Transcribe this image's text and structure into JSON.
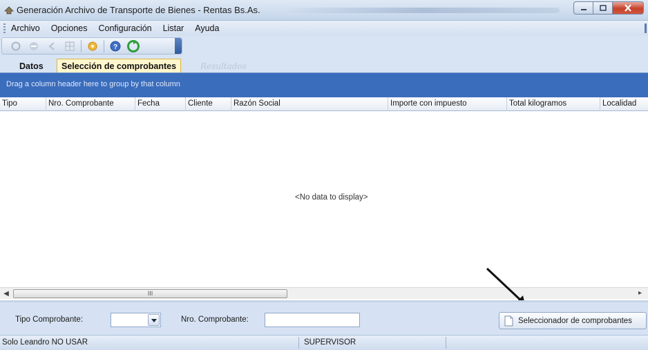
{
  "window": {
    "title": "Generación Archivo de Transporte de Bienes - Rentas Bs.As."
  },
  "menu": [
    {
      "label": "Archivo"
    },
    {
      "label": "Opciones"
    },
    {
      "label": "Configuración"
    },
    {
      "label": "Listar"
    },
    {
      "label": "Ayuda"
    }
  ],
  "toolbar": {
    "icons": [
      "refresh-icon",
      "stop-icon",
      "back-icon",
      "grid-icon",
      "settings-gear-icon",
      "help-icon",
      "go-green-icon"
    ]
  },
  "tabs": [
    {
      "label": "Datos",
      "active": false
    },
    {
      "label": "Selección de comprobantes",
      "active": true
    },
    {
      "label": "Resultados",
      "active": false,
      "disabled": true
    }
  ],
  "grid": {
    "group_panel_text": "Drag a column header here to group by that column",
    "columns": [
      "Tipo",
      "Nro. Comprobante",
      "Fecha",
      "Cliente",
      "Razón Social",
      "Importe con impuesto",
      "Total kilogramos",
      "Localidad"
    ],
    "empty_text": "<No data to display>",
    "scroll_thumb_label": "III"
  },
  "filters": {
    "tipo_label": "Tipo Comprobante:",
    "tipo_value": "",
    "nro_label": "Nro. Comprobante:",
    "nro_value": "",
    "select_button": "Seleccionador de comprobantes"
  },
  "status": {
    "user": "Solo Leandro NO USAR",
    "role": "SUPERVISOR"
  },
  "colors": {
    "group_panel": "#3b6dbd",
    "active_tab": "#fff6cd",
    "background": "#d6e2f3"
  }
}
